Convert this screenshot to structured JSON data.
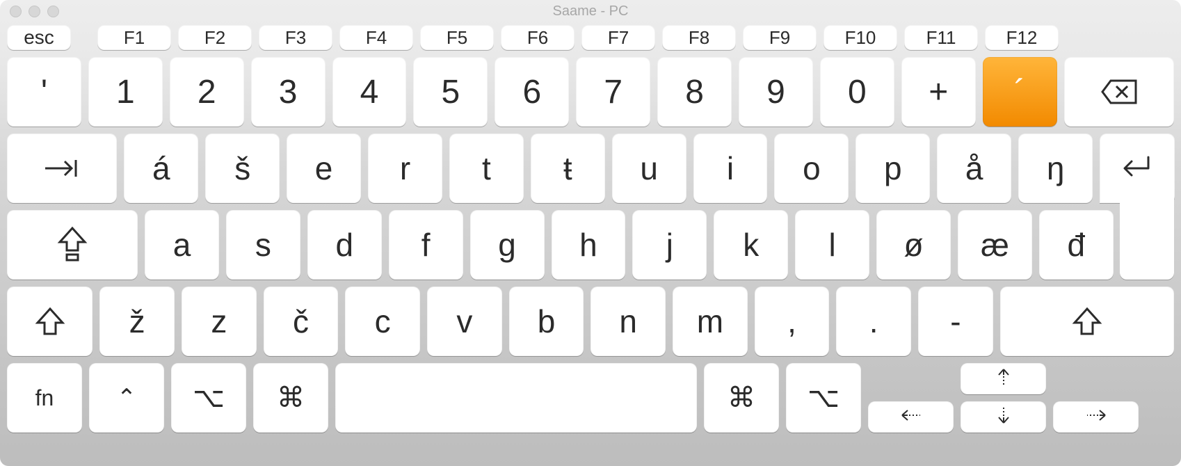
{
  "window": {
    "title": "Saame - PC"
  },
  "fn_row": {
    "esc": "esc",
    "keys": [
      "F1",
      "F2",
      "F3",
      "F4",
      "F5",
      "F6",
      "F7",
      "F8",
      "F9",
      "F10",
      "F11",
      "F12"
    ]
  },
  "row1": {
    "keys": [
      "'",
      "1",
      "2",
      "3",
      "4",
      "5",
      "6",
      "7",
      "8",
      "9",
      "0",
      "+"
    ],
    "dead_key": "´"
  },
  "row2": {
    "keys": [
      "á",
      "š",
      "e",
      "r",
      "t",
      "ŧ",
      "u",
      "i",
      "o",
      "p",
      "å",
      "ŋ"
    ]
  },
  "row3": {
    "keys": [
      "a",
      "s",
      "d",
      "f",
      "g",
      "h",
      "j",
      "k",
      "l",
      "ø",
      "æ",
      "đ"
    ]
  },
  "row4": {
    "keys": [
      "ž",
      "z",
      "č",
      "c",
      "v",
      "b",
      "n",
      "m",
      ",",
      ".",
      "-"
    ]
  },
  "row5": {
    "fn": "fn"
  },
  "icons": {
    "backspace": "backspace-icon",
    "tab": "tab-icon",
    "enter": "enter-icon",
    "capslock": "capslock-icon",
    "shift": "shift-icon",
    "control": "control-icon",
    "option": "option-icon",
    "command": "command-icon",
    "arrow_up": "arrow-up-dotted-icon",
    "arrow_down": "arrow-down-dotted-icon",
    "arrow_left": "arrow-left-dotted-icon",
    "arrow_right": "arrow-right-dotted-icon"
  }
}
